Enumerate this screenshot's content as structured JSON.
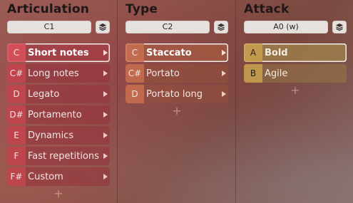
{
  "columns": [
    {
      "title": "Articulation",
      "selector_value": "C1",
      "items": [
        {
          "key": "C",
          "label": "Short notes",
          "selected": true
        },
        {
          "key": "C#",
          "label": "Long notes"
        },
        {
          "key": "D",
          "label": "Legato"
        },
        {
          "key": "D#",
          "label": "Portamento"
        },
        {
          "key": "E",
          "label": "Dynamics"
        },
        {
          "key": "F",
          "label": "Fast repetitions"
        },
        {
          "key": "F#",
          "label": "Custom"
        }
      ],
      "add_label": "+"
    },
    {
      "title": "Type",
      "selector_value": "C2",
      "items": [
        {
          "key": "C",
          "label": "Staccato",
          "selected": true
        },
        {
          "key": "C#",
          "label": "Portato"
        },
        {
          "key": "D",
          "label": "Portato long"
        }
      ],
      "add_label": "+"
    },
    {
      "title": "Attack",
      "selector_value": "A0 (w)",
      "items": [
        {
          "key": "A",
          "label": "Bold",
          "selected": true
        },
        {
          "key": "B",
          "label": "Agile"
        }
      ],
      "add_label": "+"
    }
  ],
  "icons": {
    "selector_button": "layers-icon",
    "item_arrow": "chevron-right-icon"
  },
  "colors": {
    "articulation_key": "#c84650",
    "type_key": "#c86e50",
    "attack_key": "#c8a050",
    "selector_bg": "#e6e1dc",
    "selected_outline": "#f4eeea"
  }
}
